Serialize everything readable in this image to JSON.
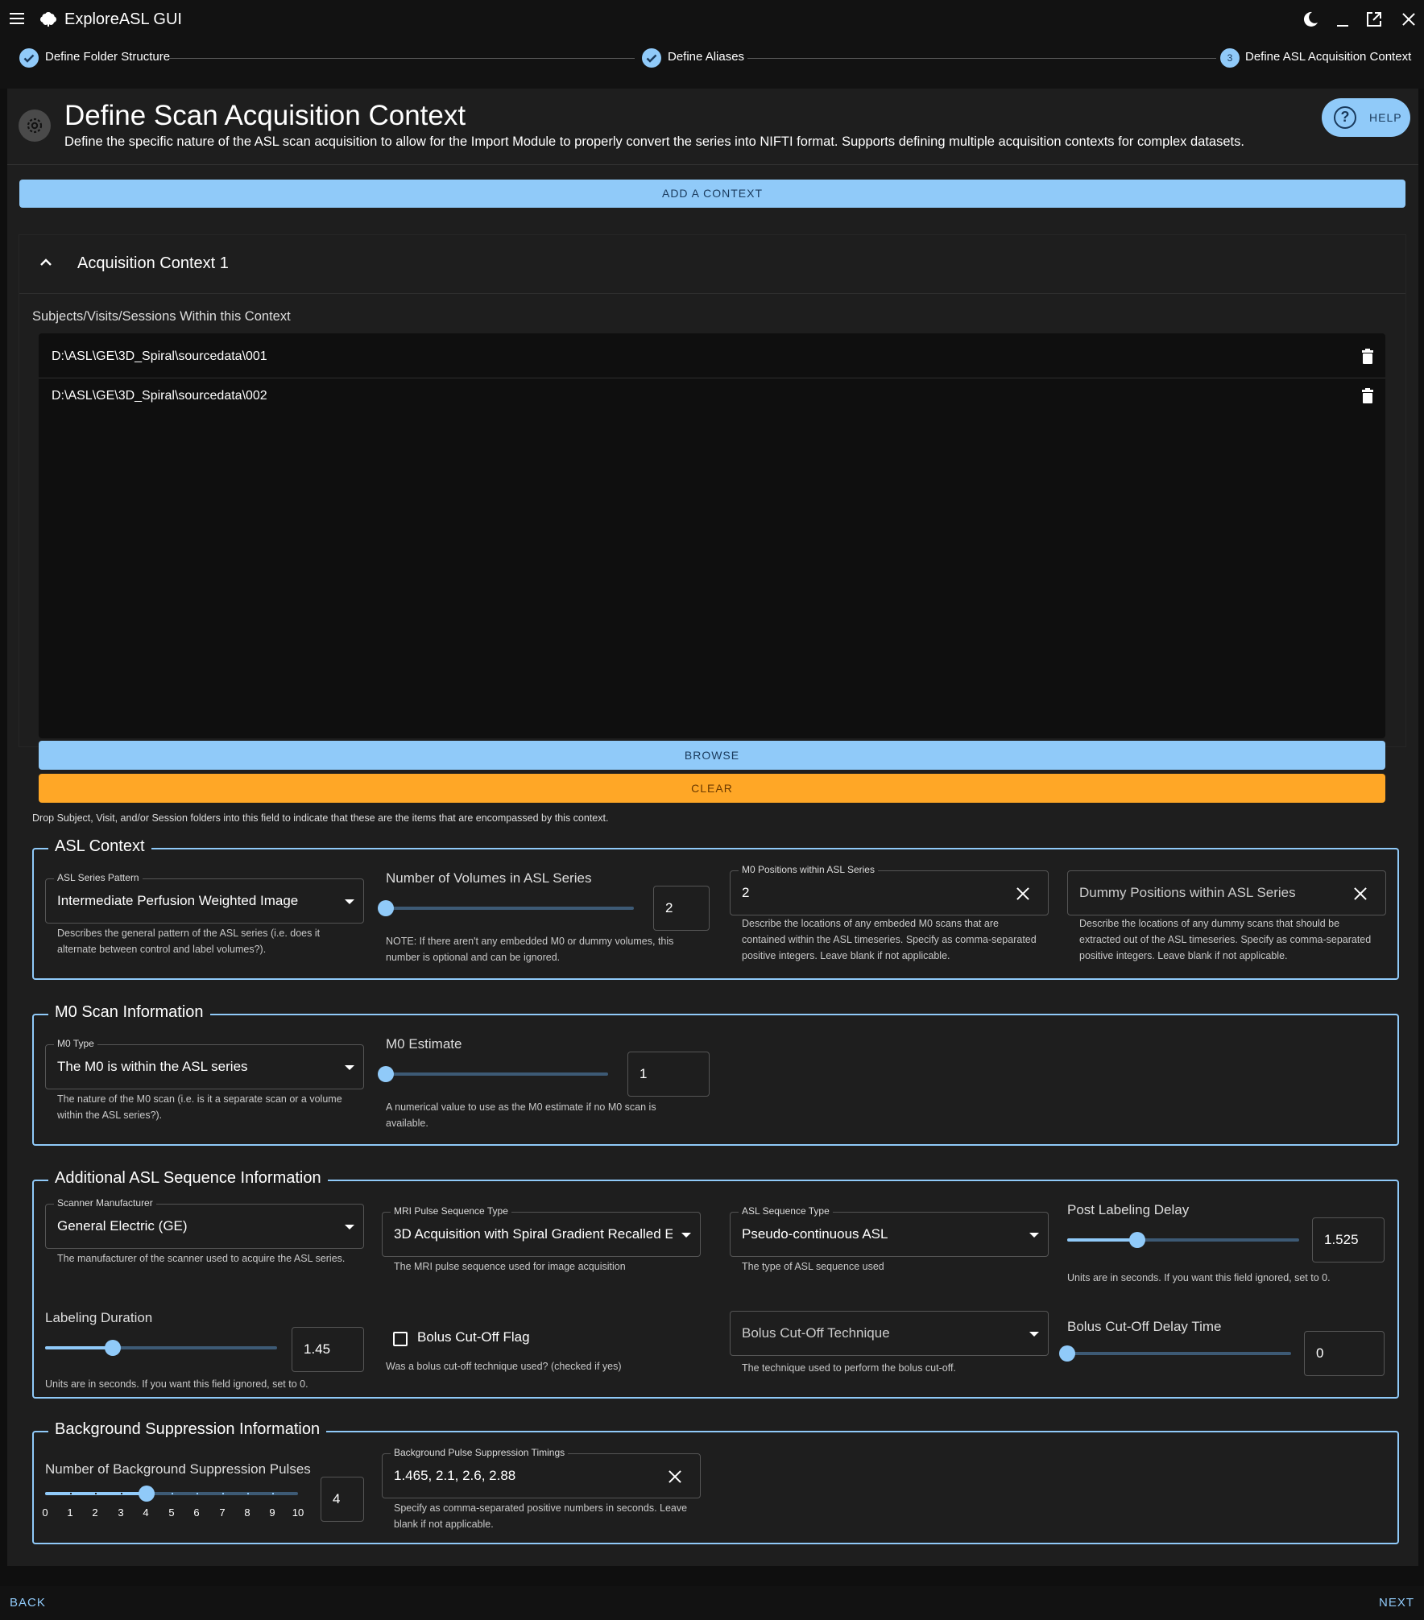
{
  "app": {
    "title": "ExploreASL GUI"
  },
  "stepper": {
    "steps": [
      {
        "label": "Define Folder Structure",
        "state": "completed"
      },
      {
        "label": "Define Aliases",
        "state": "completed"
      },
      {
        "label": "Define ASL Acquisition Context",
        "state": "active",
        "number": "3"
      }
    ]
  },
  "header": {
    "title": "Define Scan Acquisition Context",
    "description": "Define the specific nature of the ASL scan acquisition to allow for the Import Module to properly convert the series into NIFTI format. Supports defining multiple acquisition contexts for complex datasets.",
    "help_label": "HELP"
  },
  "add_context_label": "ADD A CONTEXT",
  "context": {
    "title": "Acquisition Context 1",
    "paths_label": "Subjects/Visits/Sessions Within this Context",
    "paths": [
      "D:\\ASL\\GE\\3D_Spiral\\sourcedata\\001",
      "D:\\ASL\\GE\\3D_Spiral\\sourcedata\\002"
    ],
    "browse_label": "BROWSE",
    "clear_label": "CLEAR",
    "drop_hint": "Drop Subject, Visit, and/or Session folders into this field to indicate that these are the items that are encompassed by this context."
  },
  "asl_context": {
    "legend": "ASL Context",
    "series_pattern": {
      "label": "ASL Series Pattern",
      "value": "Intermediate Perfusion Weighted Image",
      "help": "Describes the general pattern of the ASL series (i.e. does it alternate between control and label volumes?)."
    },
    "num_volumes": {
      "label": "Number of Volumes in ASL Series",
      "value": "2",
      "fraction": 0.0,
      "help": "NOTE: If there aren't any embedded M0 or dummy volumes, this number is optional and can be ignored."
    },
    "m0_positions": {
      "label": "M0 Positions within ASL Series",
      "value": "2",
      "help": "Describe the locations of any embeded M0 scans that are contained within the ASL timeseries. Specify as comma-separated positive integers. Leave blank if not applicable."
    },
    "dummy_positions": {
      "placeholder": "Dummy Positions within ASL Series",
      "help": "Describe the locations of any dummy scans that should be extracted out of the ASL timeseries. Specify as comma-separated positive integers. Leave blank if not applicable."
    }
  },
  "m0_info": {
    "legend": "M0 Scan Information",
    "m0_type": {
      "label": "M0 Type",
      "value": "The M0 is within the ASL series",
      "help": "The nature of the M0 scan (i.e. is it a separate scan or a volume within the ASL series?)."
    },
    "m0_estimate": {
      "label": "M0 Estimate",
      "value": "1",
      "fraction": 0.0,
      "help": "A numerical value to use as the M0 estimate if no M0 scan is available."
    }
  },
  "additional": {
    "legend": "Additional ASL Sequence Information",
    "manufacturer": {
      "label": "Scanner Manufacturer",
      "value": "General Electric (GE)",
      "help": "The manufacturer of the scanner used to acquire the ASL series."
    },
    "pulse_seq": {
      "label": "MRI Pulse Sequence Type",
      "value": "3D Acquisition with Spiral Gradient Recalled E...",
      "help": "The MRI pulse sequence used for image acquisition"
    },
    "asl_seq_type": {
      "label": "ASL Sequence Type",
      "value": "Pseudo-continuous ASL",
      "help": "The type of ASL sequence used"
    },
    "pld": {
      "label": "Post Labeling Delay",
      "value": "1.525",
      "fraction": 0.3,
      "help": "Units are in seconds. If you want this field ignored, set to 0."
    },
    "labeling_duration": {
      "label": "Labeling Duration",
      "value": "1.45",
      "fraction": 0.29,
      "help": "Units are in seconds. If you want this field ignored, set to 0."
    },
    "bolus_flag": {
      "label": "Bolus Cut-Off Flag",
      "checked": false,
      "help": "Was a bolus cut-off technique used? (checked if yes)"
    },
    "bolus_technique": {
      "placeholder": "Bolus Cut-Off Technique",
      "help": "The technique used to perform the bolus cut-off."
    },
    "bolus_delay": {
      "label": "Bolus Cut-Off Delay Time",
      "value": "0",
      "fraction": 0.0
    }
  },
  "background": {
    "legend": "Background Suppression Information",
    "num_pulses": {
      "label": "Number of Background Suppression Pulses",
      "value": "4",
      "fraction": 0.4,
      "marks": [
        "0",
        "1",
        "2",
        "3",
        "4",
        "5",
        "6",
        "7",
        "8",
        "9",
        "10"
      ]
    },
    "timings": {
      "label": "Background Pulse Suppression Timings",
      "value": "1.465, 2.1, 2.6, 2.88",
      "help": "Specify as comma-separated positive numbers in seconds. Leave blank if not applicable."
    }
  },
  "footer": {
    "back_label": "BACK",
    "next_label": "NEXT"
  },
  "colors": {
    "accent": "#90caf9",
    "warning": "#ffa726",
    "panel": "#1e1e1e",
    "background": "#0f0f0f"
  }
}
